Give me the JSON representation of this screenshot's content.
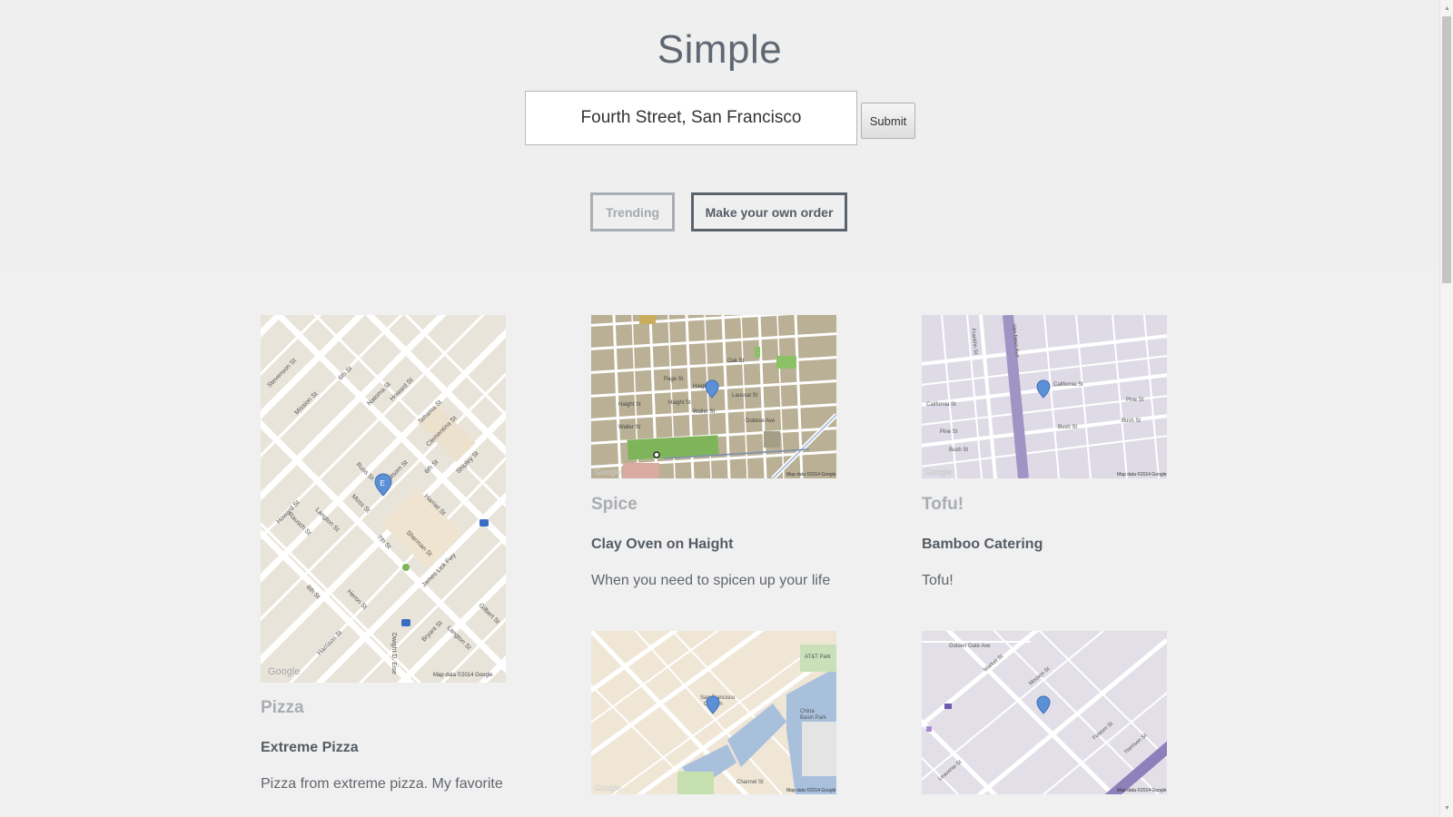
{
  "header": {
    "title": "Simple",
    "search_value": "Fourth Street, San Francisco",
    "submit_label": "Submit",
    "nav": {
      "trending_label": "Trending",
      "own_order_label": "Make your own order"
    }
  },
  "map_credit": "Map data ©2014 Google",
  "map_logo": "Google",
  "cards": [
    {
      "category": "Pizza",
      "name": "Extreme Pizza",
      "description": "Pizza from extreme pizza. My favorite",
      "map_style": "beige-diagonal"
    },
    {
      "category": "Spice",
      "name": "Clay Oven on Haight",
      "description": "When you need to spicen up your life",
      "map_style": "brown-grid"
    },
    {
      "category": "Tofu!",
      "name": "Bamboo Catering",
      "description": "Tofu!",
      "map_style": "lavender-grid"
    },
    {
      "category": "",
      "name": "",
      "description": "",
      "map_style": "beige-waterfront"
    },
    {
      "category": "",
      "name": "",
      "description": "",
      "map_style": "lavender-diagonal"
    }
  ],
  "colors": {
    "background": "#f0f0f0",
    "title": "#5f6873",
    "nav_border": "#5b636d",
    "category": "#a9adb2",
    "marker": "#5b8fd6"
  },
  "icons": {
    "map_marker": "map-marker-icon",
    "scroll_up": "scroll-up-arrow-icon",
    "scroll_down": "scroll-down-arrow-icon"
  }
}
